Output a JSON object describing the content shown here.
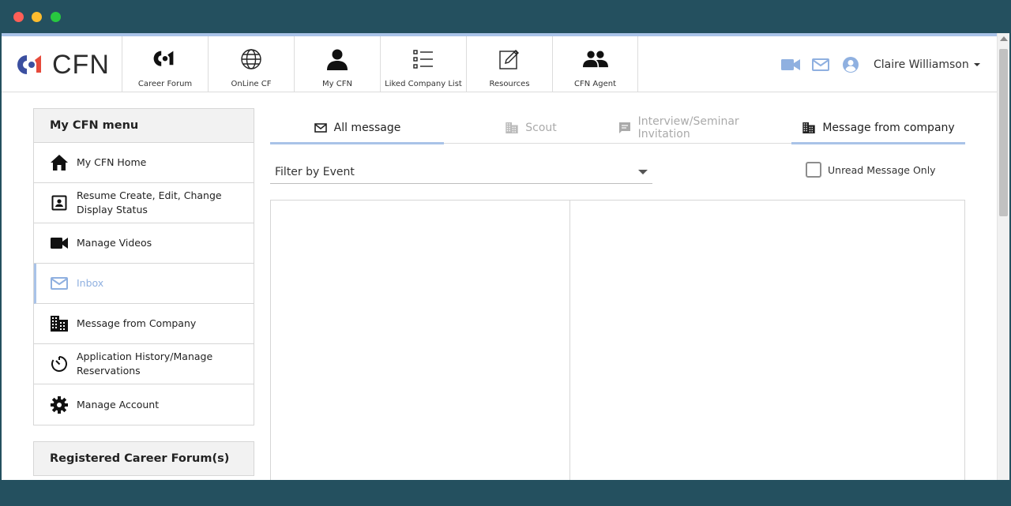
{
  "brand": {
    "name": "CFN"
  },
  "nav": [
    {
      "label": "Career Forum",
      "icon": "cf-logo-icon"
    },
    {
      "label": "OnLine CF",
      "icon": "globe-icon"
    },
    {
      "label": "My CFN",
      "icon": "person-icon"
    },
    {
      "label": "Liked Company List",
      "icon": "list-icon"
    },
    {
      "label": "Resources",
      "icon": "edit-icon"
    },
    {
      "label": "CFN Agent",
      "icon": "group-icon"
    }
  ],
  "header": {
    "user_name": "Claire Williamson"
  },
  "sidebar": {
    "title": "My CFN menu",
    "items": [
      {
        "label": "My CFN Home",
        "icon": "home-icon"
      },
      {
        "label": "Resume Create, Edit, Change Display Status",
        "icon": "contact-card-icon"
      },
      {
        "label": "Manage Videos",
        "icon": "video-camera-icon"
      },
      {
        "label": "Inbox",
        "icon": "mail-icon",
        "active": true
      },
      {
        "label": "Message from Company",
        "icon": "building-icon"
      },
      {
        "label": "Application History/Manage Reservations",
        "icon": "timer-icon"
      },
      {
        "label": "Manage Account",
        "icon": "gear-icon"
      }
    ],
    "registered_title": "Registered Career Forum(s)"
  },
  "tabs": [
    {
      "label": "All message",
      "icon": "mail-icon"
    },
    {
      "label": "Scout",
      "icon": "building-icon"
    },
    {
      "label": "Interview/Seminar Invitation",
      "icon": "chat-icon"
    },
    {
      "label": "Message from company",
      "icon": "building-icon"
    }
  ],
  "filter": {
    "label": "Filter by Event"
  },
  "unread": {
    "label": "Unread Message Only",
    "checked": false
  },
  "colors": {
    "accent": "#a9c3e8",
    "icon_blue": "#8fb0e0",
    "chrome": "#24505f"
  }
}
